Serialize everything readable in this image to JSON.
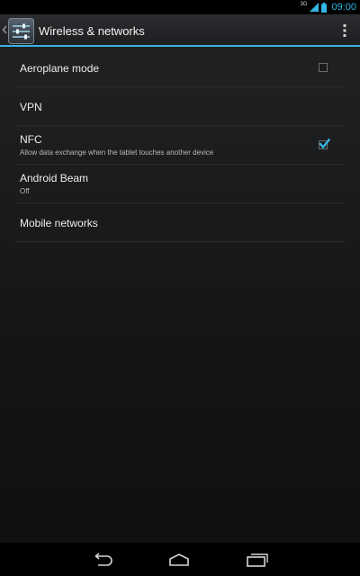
{
  "status_bar": {
    "network_type": "3G",
    "time": "09:00",
    "icons": [
      "signal-icon",
      "battery-icon"
    ]
  },
  "action_bar": {
    "title": "Wireless & networks",
    "icons": [
      "up-caret-icon",
      "settings-sliders-icon",
      "overflow-menu-icon"
    ],
    "accent_color": "#33b5e5"
  },
  "preferences": [
    {
      "title": "Aeroplane mode",
      "summary": "",
      "has_checkbox": true,
      "checked": false
    },
    {
      "title": "VPN",
      "summary": "",
      "has_checkbox": false
    },
    {
      "title": "NFC",
      "summary": "Allow data exchange when the tablet touches another device",
      "has_checkbox": true,
      "checked": true
    },
    {
      "title": "Android Beam",
      "summary": "Off",
      "has_checkbox": false
    },
    {
      "title": "Mobile networks",
      "summary": "",
      "has_checkbox": false
    }
  ],
  "nav_bar": {
    "icons": [
      "back-icon",
      "home-icon",
      "recent-apps-icon"
    ]
  }
}
